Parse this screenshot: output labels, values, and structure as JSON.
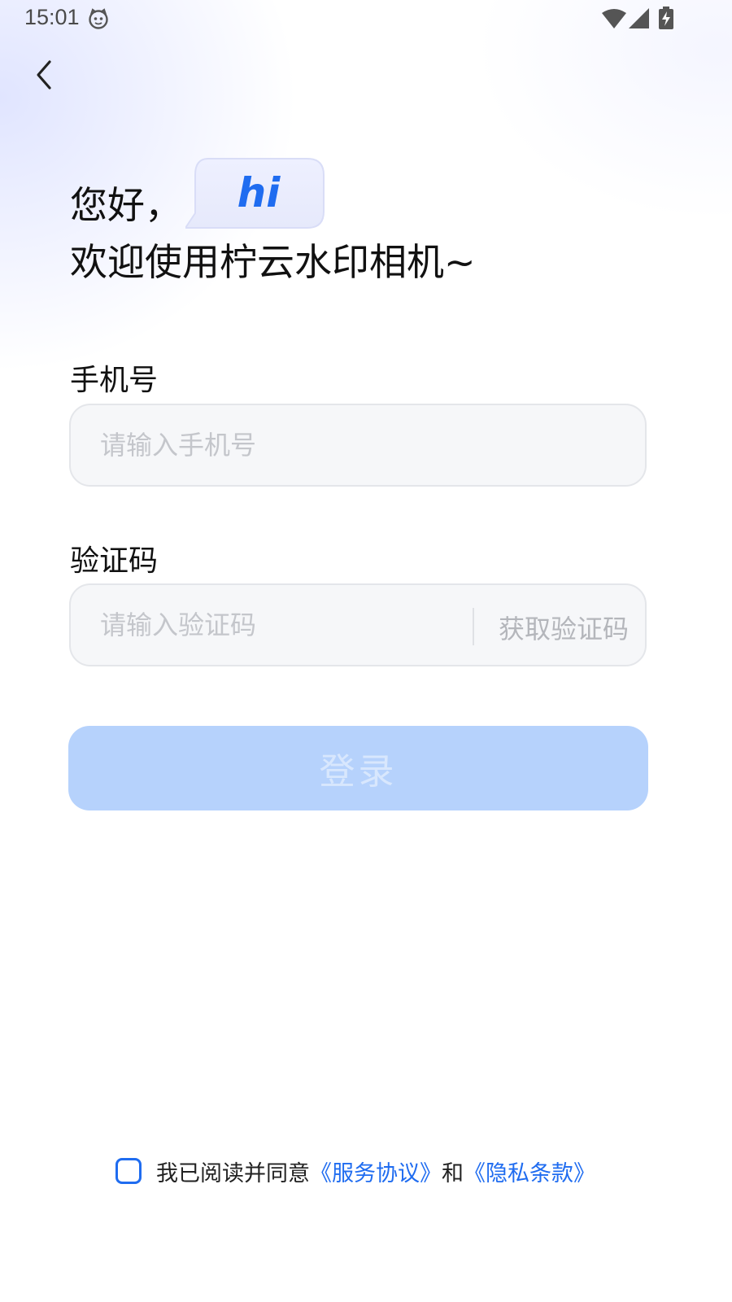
{
  "status_bar": {
    "time": "15:01",
    "icons": [
      "cat-face-icon",
      "wifi-icon",
      "signal-icon",
      "battery-charging-icon"
    ]
  },
  "nav": {
    "back_icon": "chevron-left-icon"
  },
  "greeting": {
    "line1": "您好，",
    "hi": "hi",
    "line2": "欢迎使用柠云水印相机~"
  },
  "phone": {
    "label": "手机号",
    "value": "",
    "placeholder": "请输入手机号"
  },
  "code": {
    "label": "验证码",
    "value": "",
    "placeholder": "请输入验证码",
    "get_code": "获取验证码"
  },
  "login": {
    "label": "登录"
  },
  "agreement": {
    "text": "我已阅读并同意",
    "service_link": "《服务协议》",
    "and": "和",
    "privacy_link": "《隐私条款》",
    "checked": false
  },
  "colors": {
    "accent": "#1f6cf0",
    "login_bg": "#b6d2fc",
    "input_bg": "#f6f7f9",
    "placeholder": "#c4c6cb"
  }
}
